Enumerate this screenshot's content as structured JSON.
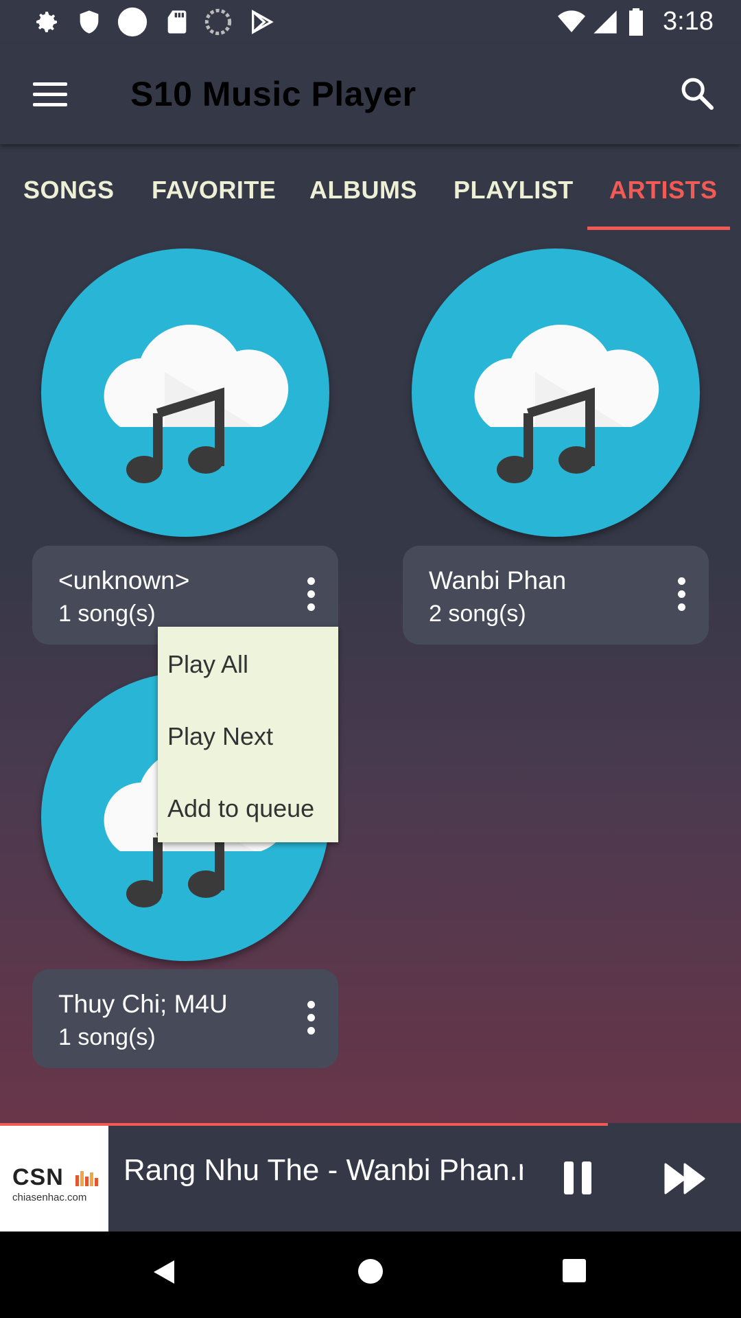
{
  "status_bar": {
    "time": "3:18",
    "icons": [
      "gear-icon",
      "shield-icon",
      "circle-icon",
      "sd-card-icon",
      "sync-icon",
      "play-store-icon",
      "wifi-icon",
      "signal-icon",
      "battery-icon"
    ]
  },
  "app_bar": {
    "title": "S10 Music Player",
    "menu_icon": "hamburger-menu-icon",
    "search_icon": "search-icon"
  },
  "tabs": [
    {
      "label": "SONGS",
      "active": false
    },
    {
      "label": "FAVORITE",
      "active": false
    },
    {
      "label": "ALBUMS",
      "active": false
    },
    {
      "label": "PLAYLIST",
      "active": false
    },
    {
      "label": "ARTISTS",
      "active": true
    }
  ],
  "artists": [
    {
      "name": "<unknown>",
      "count": "1 song(s)"
    },
    {
      "name": "Wanbi Phan",
      "count": "2 song(s)"
    },
    {
      "name": "Thuy Chi; M4U",
      "count": "1 song(s)"
    }
  ],
  "context_menu": {
    "items": [
      "Play All",
      "Play Next",
      "Add to queue"
    ]
  },
  "now_playing": {
    "album_brand": "CSN",
    "album_site": "chiasenhac.com",
    "track": "Rang Nhu The - Wanbi Phan.m",
    "progress": 0.82
  },
  "colors": {
    "accent": "#f25a55",
    "background": "#353847",
    "card": "#474a59",
    "circle": "#29b6d6",
    "tab_text": "#eef0d6",
    "menu_bg": "#eef3dc"
  }
}
